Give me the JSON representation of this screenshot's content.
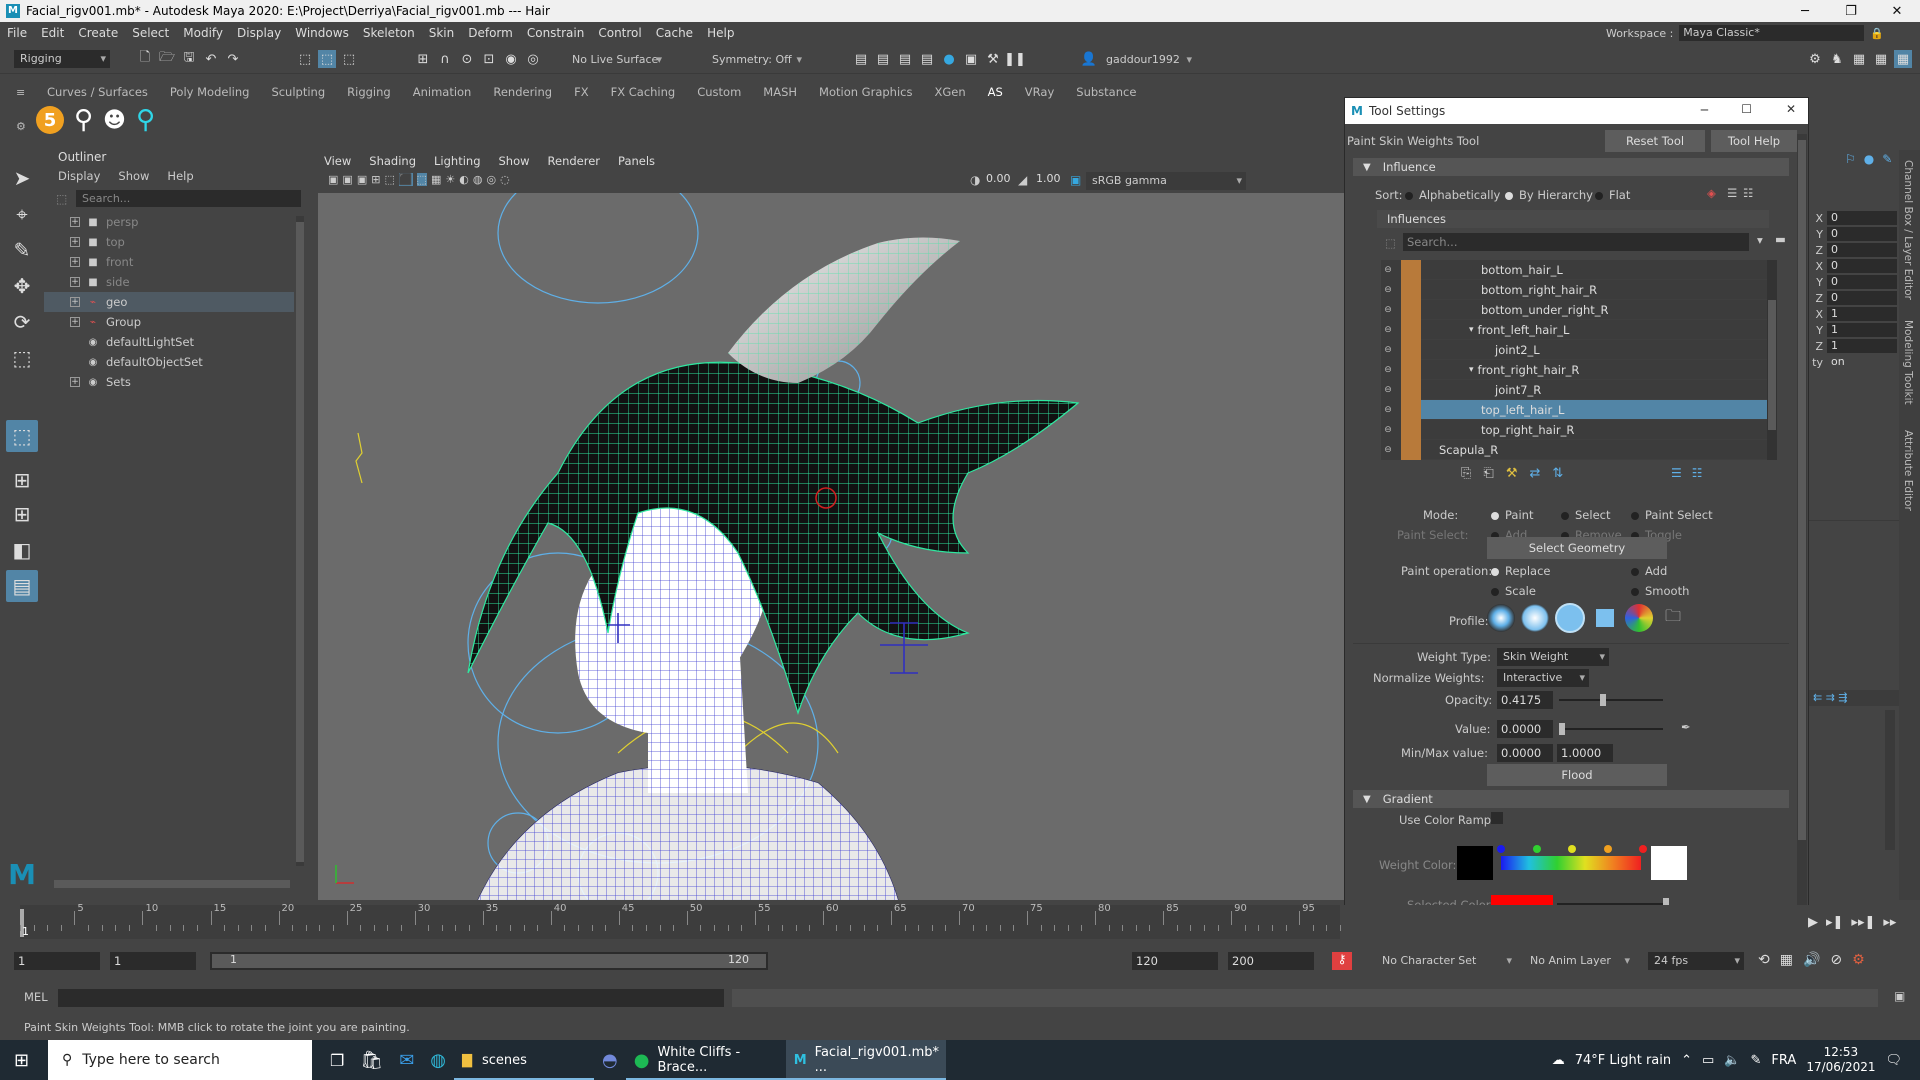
{
  "titlebar": {
    "title": "Facial_rigv001.mb* - Autodesk Maya 2020: E:\\Project\\Derriya\\Facial_rigv001.mb  ---  Hair",
    "logo": "M"
  },
  "menubar": {
    "items": [
      "File",
      "Edit",
      "Create",
      "Select",
      "Modify",
      "Display",
      "Windows",
      "Skeleton",
      "Skin",
      "Deform",
      "Constrain",
      "Control",
      "Cache",
      "Help"
    ],
    "workspace_label": "Workspace :",
    "workspace_value": "Maya Classic*"
  },
  "statusline": {
    "menuset": "Rigging",
    "live_surface": "No Live Surface",
    "symmetry": "Symmetry: Off",
    "user": "gaddour1992"
  },
  "shelf": {
    "tabs": [
      "Curves / Surfaces",
      "Poly Modeling",
      "Sculpting",
      "Rigging",
      "Animation",
      "Rendering",
      "FX",
      "FX Caching",
      "Custom",
      "MASH",
      "Motion Graphics",
      "XGen",
      "AS",
      "VRay",
      "Substance"
    ],
    "active_tab": "AS",
    "badge": "5"
  },
  "outliner": {
    "title": "Outliner",
    "menu": [
      "Display",
      "Show",
      "Help"
    ],
    "search_placeholder": "Search...",
    "items": [
      {
        "label": "persp",
        "icon": "camera-icon",
        "dim": true
      },
      {
        "label": "top",
        "icon": "camera-icon",
        "dim": true
      },
      {
        "label": "front",
        "icon": "camera-icon",
        "dim": true
      },
      {
        "label": "side",
        "icon": "camera-icon",
        "dim": true
      },
      {
        "label": "geo",
        "icon": "group-icon",
        "dim": false
      },
      {
        "label": "Group",
        "icon": "group-icon",
        "dim": false
      },
      {
        "label": "defaultLightSet",
        "icon": "set-icon",
        "dim": false
      },
      {
        "label": "defaultObjectSet",
        "icon": "set-icon",
        "dim": false
      },
      {
        "label": "Sets",
        "icon": "set-icon",
        "dim": false
      }
    ]
  },
  "viewport": {
    "menu": [
      "View",
      "Shading",
      "Lighting",
      "Show",
      "Renderer",
      "Panels"
    ],
    "field1": "0.00",
    "field2": "1.00",
    "colorspace": "sRGB gamma"
  },
  "toolsettings": {
    "window_title": "Tool Settings",
    "tool_name": "Paint Skin Weights Tool",
    "reset_label": "Reset Tool",
    "help_label": "Tool Help",
    "influence_label": "Influence",
    "sort_label": "Sort:",
    "sort_options": [
      "Alphabetically",
      "By Hierarchy",
      "Flat"
    ],
    "influences_label": "Influences",
    "search_placeholder": "Search...",
    "influences": [
      {
        "label": "bottom_hair_L",
        "indent": 1,
        "selected": false
      },
      {
        "label": "bottom_right_hair_R",
        "indent": 1,
        "selected": false
      },
      {
        "label": "bottom_under_right_R",
        "indent": 1,
        "selected": false
      },
      {
        "label": "front_left_hair_L",
        "indent": 1,
        "selected": false
      },
      {
        "label": "joint2_L",
        "indent": 2,
        "selected": false
      },
      {
        "label": "front_right_hair_R",
        "indent": 1,
        "selected": false
      },
      {
        "label": "joint7_R",
        "indent": 2,
        "selected": false
      },
      {
        "label": "top_left_hair_L",
        "indent": 1,
        "selected": true
      },
      {
        "label": "top_right_hair_R",
        "indent": 1,
        "selected": false
      },
      {
        "label": "Scapula_R",
        "indent": 0,
        "selected": false
      }
    ],
    "mode_label": "Mode:",
    "mode_options": [
      "Paint",
      "Select",
      "Paint Select"
    ],
    "paint_select_label": "Paint Select:",
    "paint_select_options": [
      "Add",
      "Remove",
      "Toggle"
    ],
    "select_geometry_label": "Select Geometry",
    "paint_operation_label": "Paint operation:",
    "paint_operations": [
      "Replace",
      "Add",
      "Scale",
      "Smooth"
    ],
    "profile_label": "Profile:",
    "weight_type_label": "Weight Type:",
    "weight_type_value": "Skin Weight",
    "normalize_label": "Normalize Weights:",
    "normalize_value": "Interactive",
    "opacity_label": "Opacity:",
    "opacity_value": "0.4175",
    "opacity_fraction": 0.4175,
    "value_label": "Value:",
    "value_value": "0.0000",
    "minmax_label": "Min/Max value:",
    "min_value": "0.0000",
    "max_value": "1.0000",
    "flood_label": "Flood",
    "gradient_label": "Gradient",
    "use_color_ramp_label": "Use Color Ramp",
    "weight_color_label": "Weight Color:",
    "selected_color_label": "Selected Color:",
    "selected_color": "#ff0000"
  },
  "channelbox": {
    "rows": [
      {
        "axis": "X",
        "value": "0"
      },
      {
        "axis": "Y",
        "value": "0"
      },
      {
        "axis": "Z",
        "value": "0"
      },
      {
        "axis": "X",
        "value": "0"
      },
      {
        "axis": "Y",
        "value": "0"
      },
      {
        "axis": "Z",
        "value": "0"
      },
      {
        "axis": "X",
        "value": "1"
      },
      {
        "axis": "Y",
        "value": "1"
      },
      {
        "axis": "Z",
        "value": "1"
      },
      {
        "axis": "ty",
        "value": "on"
      }
    ],
    "side_tabs": [
      "Channel Box / Layer Editor",
      "Modeling Toolkit",
      "Attribute Editor"
    ]
  },
  "timeline": {
    "ticks": [
      "5",
      "10",
      "15",
      "20",
      "25",
      "30",
      "35",
      "40",
      "45",
      "50",
      "55",
      "60",
      "65",
      "70",
      "75",
      "80",
      "85",
      "90",
      "95"
    ],
    "current": "1"
  },
  "rangebar": {
    "start": "1",
    "cur": "1",
    "range_start": "1",
    "range_end_inner": "120",
    "range_end": "120",
    "anim_end": "200",
    "character_set": "No Character Set",
    "anim_layer": "No Anim Layer",
    "fps": "24 fps"
  },
  "mel": {
    "label": "MEL"
  },
  "helpline": {
    "text": "Paint Skin Weights Tool: MMB click to rotate the joint you are painting."
  },
  "taskbar": {
    "search_placeholder": "Type here to search",
    "apps": [
      {
        "label": "scenes",
        "icon": "folder-icon"
      },
      {
        "label": "White Cliffs - Brace...",
        "icon": "spotify-icon"
      },
      {
        "label": "Facial_rigv001.mb* ...",
        "icon": "maya-icon"
      }
    ],
    "weather": "74°F  Light rain",
    "lang": "FRA",
    "time": "12:53",
    "date": "17/06/2021"
  }
}
